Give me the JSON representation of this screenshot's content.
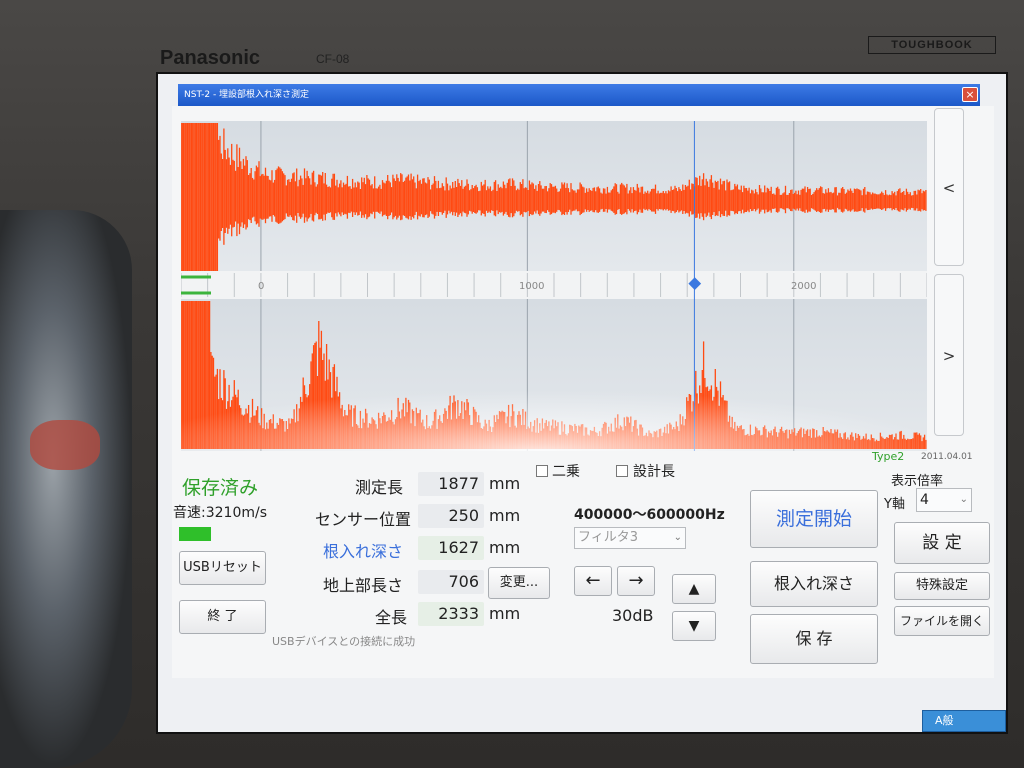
{
  "device": {
    "brand": "Panasonic",
    "model": "CF-08",
    "series": "TOUGHBOOK"
  },
  "window": {
    "title": "NST-2 - 埋設部根入れ深さ測定",
    "close_label": "×"
  },
  "chart_data": [
    {
      "type": "line",
      "panel": "top",
      "title": "",
      "color": "#ff4a12",
      "x_ticks": [
        0,
        1000,
        2000
      ],
      "x_range": [
        -300,
        2500
      ],
      "cursor_x": 1627,
      "description_values": [
        0.98,
        0.92,
        0.6,
        0.38,
        0.35,
        0.33,
        0.3,
        0.28,
        0.3,
        0.27,
        0.25,
        0.24,
        0.25,
        0.22,
        0.21,
        0.2,
        0.2,
        0.19,
        0.18,
        0.35,
        0.2,
        0.18,
        0.17,
        0.17,
        0.16,
        0.16,
        0.15,
        0.15
      ]
    },
    {
      "type": "line",
      "panel": "bottom",
      "title": "",
      "color": "#ff4a12",
      "x_ticks": [
        0,
        1000,
        2000
      ],
      "x_range": [
        -300,
        2500
      ],
      "cursor_x": 1627,
      "description_values": [
        0.98,
        0.7,
        0.45,
        0.25,
        0.2,
        0.9,
        0.3,
        0.25,
        0.35,
        0.22,
        0.4,
        0.2,
        0.3,
        0.2,
        0.18,
        0.15,
        0.25,
        0.12,
        0.2,
        0.75,
        0.18,
        0.16,
        0.14,
        0.15,
        0.12,
        0.1,
        0.12,
        0.1
      ]
    }
  ],
  "axis_labels": {
    "tick_0": "0",
    "tick_1000": "1000",
    "tick_2000": "2000"
  },
  "nav": {
    "prev": "<",
    "next": ">"
  },
  "status": {
    "saved": "保存済み",
    "sound_speed": "音速:3210m/s",
    "indicator_color": "#2fbf2a"
  },
  "buttons": {
    "usb_reset": "USBリセット",
    "exit": "終 了",
    "change": "変更...",
    "start": "測定開始",
    "depth": "根入れ深さ",
    "save": "保 存",
    "settings": "設 定",
    "special": "特殊設定",
    "open_file": "ファイルを開く",
    "left_arrow": "←",
    "right_arrow": "→",
    "up_arrow": "▲",
    "down_arrow": "▼"
  },
  "measurements": {
    "measure_length": {
      "label": "測定長",
      "value": "1877",
      "unit": "mm"
    },
    "sensor_position": {
      "label": "センサー位置",
      "value": "250",
      "unit": "mm"
    },
    "embed_depth": {
      "label": "根入れ深さ",
      "value": "1627",
      "unit": "mm"
    },
    "above_ground": {
      "label": "地上部長さ",
      "value": "706",
      "unit": ""
    },
    "total_length": {
      "label": "全長",
      "value": "2333",
      "unit": "mm"
    }
  },
  "options": {
    "square_label": "二乗",
    "design_length_label": "設計長",
    "frequency": "400000～600000Hz",
    "filter": "フィルタ3",
    "gain": "30dB"
  },
  "info": {
    "type": "Type2",
    "date": "2011.04.01",
    "magnification_label": "表示倍率",
    "y_axis_label": "Y軸",
    "y_axis_value": "4",
    "usb_message": "USBデバイスとの接続に成功"
  },
  "tray": {
    "ime": "A般"
  },
  "colors": {
    "accent_blue": "#3a6fdb",
    "signal": "#ff4a12",
    "status_green": "#2fa02a"
  }
}
